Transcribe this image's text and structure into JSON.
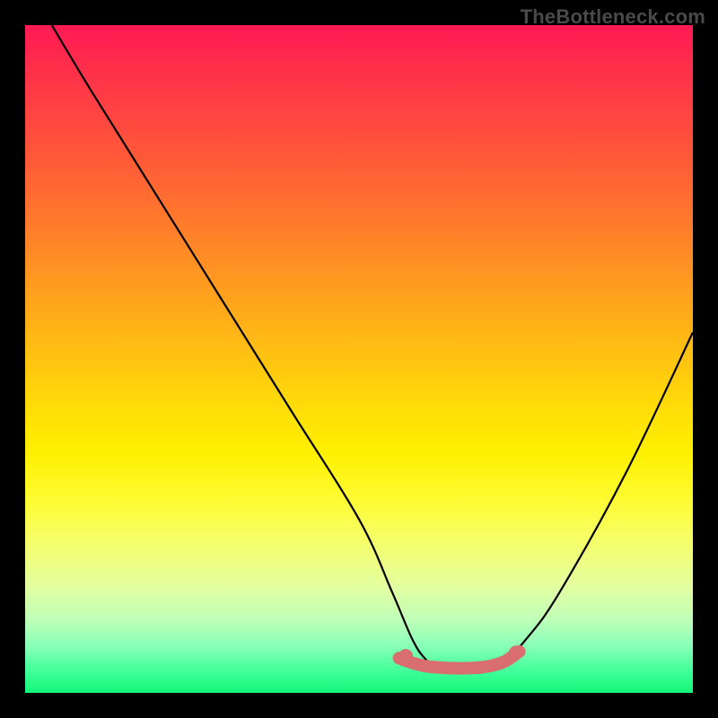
{
  "watermark": "TheBottleneck.com",
  "chart_data": {
    "type": "line",
    "title": "",
    "xlabel": "",
    "ylabel": "",
    "xlim": [
      0,
      100
    ],
    "ylim": [
      0,
      100
    ],
    "grid": false,
    "legend": false,
    "series": [
      {
        "name": "bottleneck-curve",
        "color": "#000000",
        "x": [
          4,
          10,
          20,
          30,
          40,
          50,
          55,
          58,
          60,
          62,
          64,
          66,
          68,
          70,
          72,
          75,
          80,
          90,
          100
        ],
        "values": [
          100,
          90,
          74,
          58,
          42,
          26,
          15,
          8,
          5,
          3.5,
          3,
          3,
          3,
          3.5,
          5,
          8,
          15,
          33,
          54
        ]
      },
      {
        "name": "bottom-highlight",
        "color": "#d86e6e",
        "x": [
          56,
          58,
          60,
          62,
          64,
          66,
          68,
          70,
          72,
          74
        ],
        "values": [
          5.2,
          4.5,
          4,
          3.8,
          3.7,
          3.7,
          3.8,
          4.1,
          4.8,
          6.2
        ]
      }
    ],
    "markers": [
      {
        "name": "dot-1",
        "x": 57,
        "y": 5.5,
        "color": "#d86e6e",
        "r": 8
      },
      {
        "name": "dot-2",
        "x": 73.5,
        "y": 6.0,
        "color": "#d86e6e",
        "r": 8
      }
    ],
    "colors": {
      "gradient_top": "#ff1a53",
      "gradient_mid": "#fff000",
      "gradient_bottom": "#14f57a",
      "curve": "#000000",
      "highlight": "#d86e6e",
      "frame": "#000000"
    }
  }
}
